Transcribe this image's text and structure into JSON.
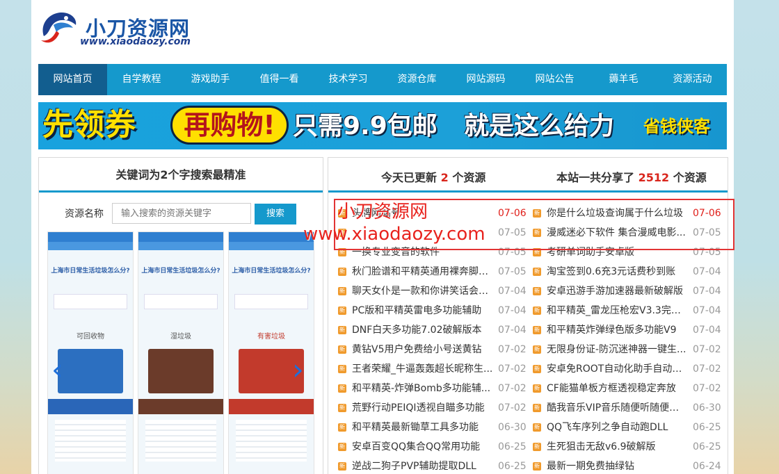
{
  "site": {
    "name": "小刀资源网",
    "url": "www.xiaodaozy.com"
  },
  "nav": {
    "items": [
      {
        "label": "网站首页"
      },
      {
        "label": "自学教程"
      },
      {
        "label": "游戏助手"
      },
      {
        "label": "值得一看"
      },
      {
        "label": "技术学习"
      },
      {
        "label": "资源仓库"
      },
      {
        "label": "网站源码"
      },
      {
        "label": "网站公告"
      },
      {
        "label": "薅羊毛"
      },
      {
        "label": "资源活动"
      }
    ]
  },
  "banner": {
    "part1": "先领券",
    "part2": "再购物!",
    "part3": "只需9.9包邮",
    "part4": "就是这么给力",
    "brand": "省钱侠客"
  },
  "search_panel": {
    "heading": "关键词为2个字搜索最精准",
    "label": "资源名称",
    "placeholder": "输入搜索的资源关键字",
    "button": "搜索",
    "slides": [
      {
        "question": "上海市日常生活垃圾怎么分?",
        "category": "可回收物"
      },
      {
        "question": "上海市日常生活垃圾怎么分?",
        "category": "湿垃圾"
      },
      {
        "question": "上海市日常生活垃圾怎么分?",
        "category": "有害垃圾"
      }
    ]
  },
  "updates": {
    "today_prefix": "今天已更新",
    "today_count": "2",
    "today_suffix": "个资源",
    "total_prefix": "本站一共分享了",
    "total_count": "2512",
    "total_suffix": "个资源",
    "badge": "新",
    "left": [
      {
        "title": "头牌网站号",
        "date": "07-06"
      },
      {
        "title": "",
        "date": "07-05"
      },
      {
        "title": "一换专业变音的软件",
        "date": "07-05"
      },
      {
        "title": "秋门脸谱和平精英通用裸奔脚本...",
        "date": "07-05"
      },
      {
        "title": "聊天女仆是一款和你讲笑话会陪...",
        "date": "07-04"
      },
      {
        "title": "PC版和平精英雷电多功能辅助",
        "date": "07-04"
      },
      {
        "title": "DNF白天多功能7.02破解版本",
        "date": "07-04"
      },
      {
        "title": "黄钻V5用户免费给小号送黄钻",
        "date": "07-02"
      },
      {
        "title": "王者荣耀_牛逼轰轰超长昵称生...",
        "date": "07-02"
      },
      {
        "title": "和平精英-炸弹Bomb多功能辅...",
        "date": "07-02"
      },
      {
        "title": "荒野行动PEIQI透视自瞄多功能",
        "date": "07-02"
      },
      {
        "title": "和平精英最新锄草工具多功能",
        "date": "06-30"
      },
      {
        "title": "安卓百变QQ集合QQ常用功能",
        "date": "06-25"
      },
      {
        "title": "逆战二狗子PVP辅助提取DLL",
        "date": "06-25"
      }
    ],
    "right": [
      {
        "title": "你是什么垃圾查询属于什么垃圾",
        "date": "07-06"
      },
      {
        "title": "漫威迷必下软件 集合漫威电影...",
        "date": "07-05"
      },
      {
        "title": "考研单词助手安卓版",
        "date": "07-05"
      },
      {
        "title": "淘宝签到0.6充3元话费秒到账",
        "date": "07-04"
      },
      {
        "title": "安卓迅游手游加速器最新破解版",
        "date": "07-04"
      },
      {
        "title": "和平精英_雷龙压枪宏V3.3完美...",
        "date": "07-04"
      },
      {
        "title": "和平精英炸弹绿色版多功能V9",
        "date": "07-04"
      },
      {
        "title": "无限身份证-防沉迷神器一键生...",
        "date": "07-02"
      },
      {
        "title": "安卓免ROOT自动化助手自动点击",
        "date": "07-02"
      },
      {
        "title": "CF能猫单板方框透视稳定奔放",
        "date": "07-02"
      },
      {
        "title": "酷我音乐VIP音乐随便听随便下载",
        "date": "06-30"
      },
      {
        "title": "QQ飞车序列之争自动跑DLL",
        "date": "06-25"
      },
      {
        "title": "生死狙击无敌v6.9破解版",
        "date": "06-25"
      },
      {
        "title": "最新一期免费抽绿钻",
        "date": "06-24"
      }
    ]
  },
  "watermark": {
    "line1": "小刀资源网",
    "line2": "www.xiaodaozy.com"
  },
  "colors": {
    "nav": "#1599cc",
    "nav_active": "#125e8f",
    "accent_red": "#e0201b",
    "badge_orange": "#f09a2c"
  }
}
